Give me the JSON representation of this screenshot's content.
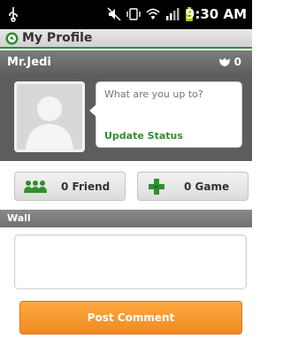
{
  "status_bar": {
    "time": "9:30 AM",
    "icons": [
      "usb-icon",
      "mute-icon",
      "vibrate-icon",
      "wifi-icon",
      "signal-icon",
      "battery-icon"
    ]
  },
  "header": {
    "title": "My Profile",
    "brand_color": "#2f8f2f"
  },
  "user": {
    "name": "Mr.Jedi",
    "karma": "0"
  },
  "status": {
    "placeholder": "What are you up to?",
    "update_label": "Update Status"
  },
  "counts": {
    "friend_label": "0 Friend",
    "game_label": "0 Game"
  },
  "wall": {
    "label": "Wall",
    "comment_value": "",
    "post_label": "Post Comment",
    "post_color": "#f08a22"
  }
}
